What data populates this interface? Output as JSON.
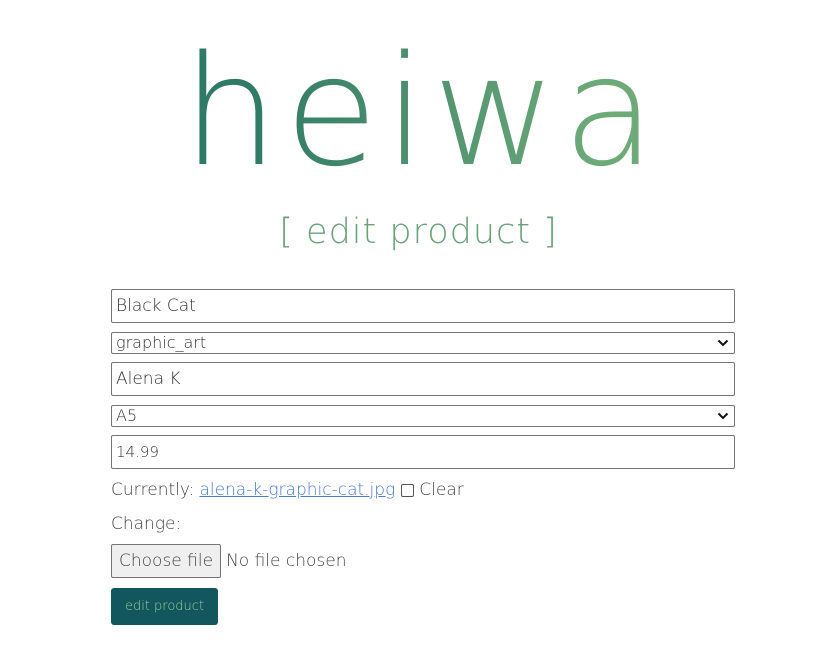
{
  "brand": {
    "name": "heiwa",
    "gradient_start": "#2f7a66",
    "gradient_end": "#6eaa78"
  },
  "heading": "[ edit product ]",
  "form": {
    "name_value": "Black Cat",
    "category_selected": "graphic_art",
    "artist_value": "Alena K",
    "size_selected": "A5",
    "price_value": "14.99",
    "image": {
      "currently_label": "Currently:",
      "current_file": "alena-k-graphic-cat.jpg",
      "clear_label": "Clear",
      "change_label": "Change:",
      "choose_button": "Choose file",
      "no_file_text": "No file chosen"
    },
    "submit_label": "edit product"
  },
  "colors": {
    "heading": "#6aa27a",
    "submit_bg": "#11575d",
    "submit_text": "#8ed29a",
    "link": "#4a7bd0"
  }
}
